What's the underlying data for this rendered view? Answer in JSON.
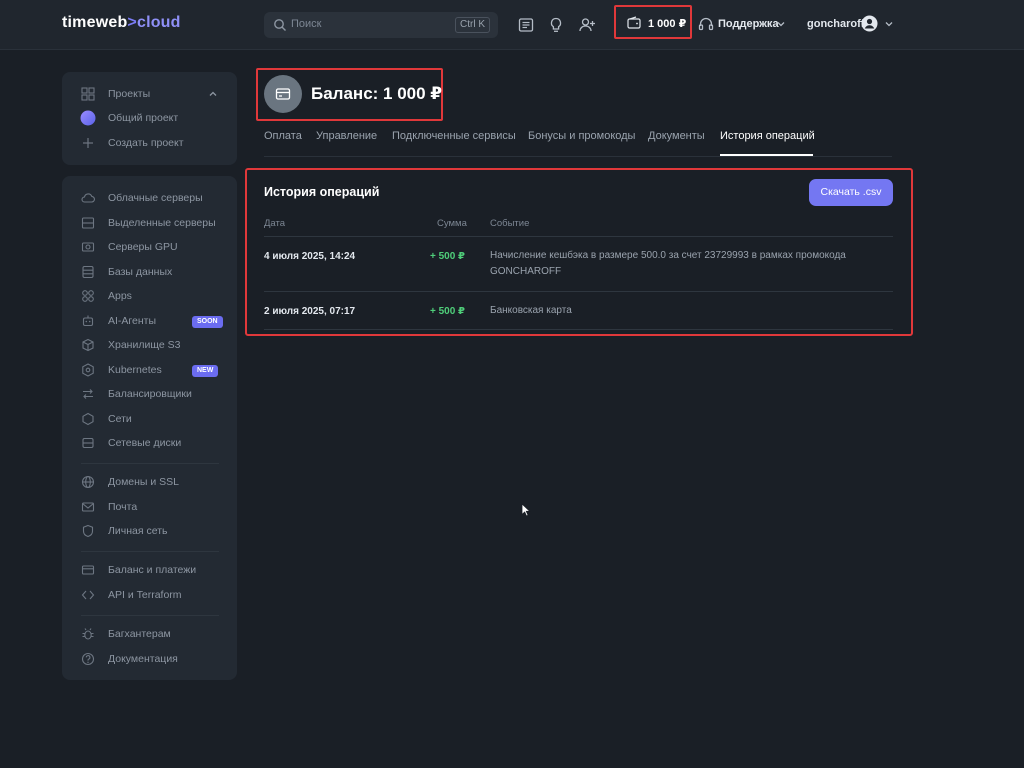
{
  "brand": {
    "logo_part1": "timeweb",
    "logo_sep": ">",
    "logo_part2": "cloud",
    "accent_color": "#7477f2"
  },
  "topbar": {
    "search_placeholder": "Поиск",
    "search_shortcut": "Ctrl K",
    "balance_amount": "1 000 ₽",
    "support_label": "Поддержка",
    "username": "goncharoff",
    "icons": [
      "news-icon",
      "lightbulb-icon",
      "add-user-icon",
      "wallet-icon",
      "headset-icon",
      "user-avatar-icon"
    ]
  },
  "sidebar": {
    "projects": {
      "header": "Проекты",
      "items": [
        "Общий проект",
        "Создать проект"
      ]
    },
    "groups": [
      {
        "label": "Облачные серверы",
        "icon": "cloud-icon"
      },
      {
        "label": "Выделенные серверы",
        "icon": "server-icon"
      },
      {
        "label": "Серверы GPU",
        "icon": "gpu-icon"
      },
      {
        "label": "Базы данных",
        "icon": "database-icon"
      },
      {
        "label": "Apps",
        "icon": "apps-icon"
      },
      {
        "label": "AI-Агенты",
        "icon": "ai-icon",
        "badge": "SOON"
      },
      {
        "label": "Хранилище S3",
        "icon": "storage-icon"
      },
      {
        "label": "Kubernetes",
        "icon": "kubernetes-icon",
        "badge": "NEW"
      },
      {
        "label": "Балансировщики",
        "icon": "balancer-icon"
      },
      {
        "label": "Сети",
        "icon": "network-icon"
      },
      {
        "label": "Сетевые диски",
        "icon": "disk-icon"
      },
      {
        "label": "Домены и SSL",
        "icon": "globe-icon"
      },
      {
        "label": "Почта",
        "icon": "mail-icon"
      },
      {
        "label": "Личная сеть",
        "icon": "shield-icon"
      },
      {
        "label": "Баланс и платежи",
        "icon": "card-icon"
      },
      {
        "label": "API и Terraform",
        "icon": "api-icon"
      },
      {
        "label": "Багхантерам",
        "icon": "bug-icon"
      },
      {
        "label": "Документация",
        "icon": "help-icon"
      }
    ]
  },
  "main": {
    "balance_title": "Баланс: 1 000 ₽",
    "tabs": [
      "Оплата",
      "Управление",
      "Подключенные сервисы",
      "Бонусы и промокоды",
      "Документы",
      "История операций"
    ],
    "active_tab": "История операций",
    "history": {
      "title": "История операций",
      "download_label": "Скачать .csv",
      "columns": [
        "Дата",
        "Сумма",
        "Событие"
      ],
      "rows": [
        {
          "date": "4 июля 2025, 14:24",
          "amount": "+ 500 ₽",
          "event": "Начисление кешбэка в размере 500.0 за счет 23729993 в рамках промокода GONCHAROFF"
        },
        {
          "date": "2 июля 2025, 07:17",
          "amount": "+ 500 ₽",
          "event": "Банковская карта"
        }
      ]
    }
  }
}
